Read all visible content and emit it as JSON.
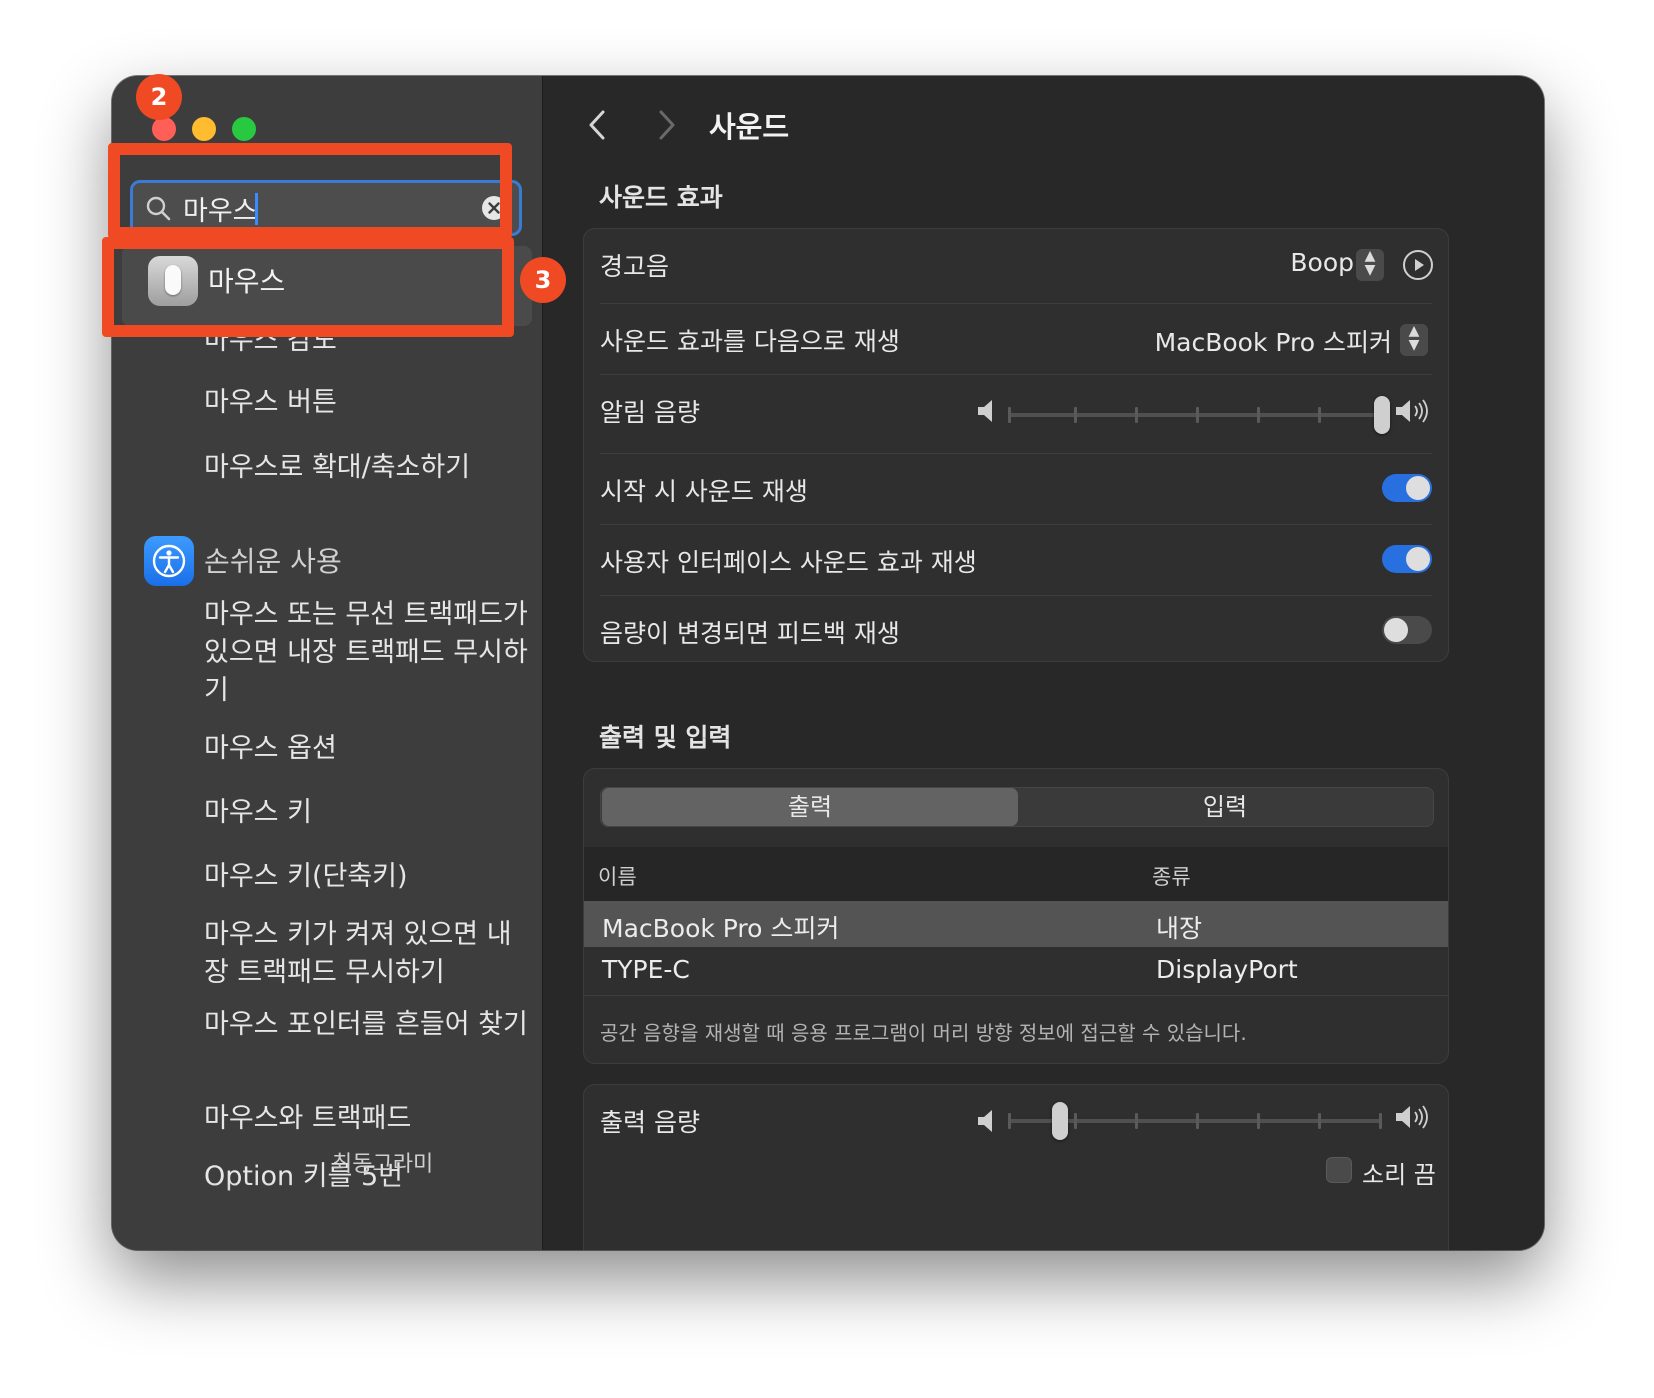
{
  "sidebar": {
    "search": {
      "value": "마우스"
    },
    "top_result": {
      "label": "마우스"
    },
    "items": [
      {
        "label": "마우스 감도"
      },
      {
        "label": "마우스 버튼"
      },
      {
        "label": "마우스로 확대/축소하기"
      }
    ],
    "accessibility": {
      "category_label": "손쉬운 사용",
      "items": [
        {
          "label": "마우스 또는 무선 트랙패드가 있으면 내장 트랙패드 무시하기"
        },
        {
          "label": "마우스 옵션"
        },
        {
          "label": "마우스 키"
        },
        {
          "label": "마우스 키(단축키)"
        },
        {
          "label": "마우스 키가 켜져 있으면 내장 트랙패드 무시하기"
        },
        {
          "label": "마우스 포인터를 흔들어 찾기"
        },
        {
          "label": "마우스와 트랙패드"
        },
        {
          "label": "Option 키를 5번"
        }
      ]
    },
    "watermark": "최동그라미"
  },
  "main": {
    "title": "사운드",
    "sound_effects": {
      "section_title": "사운드 효과",
      "alert_sound": {
        "label": "경고음",
        "value": "Boop"
      },
      "play_through": {
        "label": "사운드 효과를 다음으로 재생",
        "value": "MacBook Pro 스피커"
      },
      "alert_volume": {
        "label": "알림 음량",
        "level": 1.0
      },
      "startup_sound": {
        "label": "시작 시 사운드 재생",
        "on": true
      },
      "ui_sound": {
        "label": "사용자 인터페이스 사운드 효과 재생",
        "on": true
      },
      "feedback": {
        "label": "음량이 변경되면 피드백 재생",
        "on": false
      }
    },
    "output_input": {
      "section_title": "출력 및 입력",
      "tabs": [
        {
          "label": "출력",
          "selected": true
        },
        {
          "label": "입력",
          "selected": false
        }
      ],
      "columns": [
        "이름",
        "종류"
      ],
      "devices": [
        {
          "name": "MacBook Pro 스피커",
          "type": "내장",
          "selected": true
        },
        {
          "name": "TYPE-C",
          "type": "DisplayPort",
          "selected": false
        }
      ],
      "note": "공간 음향을 재생할 때 응용 프로그램이 머리 방향 정보에 접근할 수 있습니다."
    },
    "output_volume": {
      "label": "출력 음량",
      "level": 0.14,
      "mute_label": "소리 끔",
      "muted": false
    }
  },
  "annotations": {
    "badge_2": "2",
    "badge_3": "3",
    "color": "#f04a24"
  },
  "colors": {
    "accent": "#2870e0",
    "close": "#ff5f57",
    "minimize": "#febc2e",
    "maximize": "#28c840"
  }
}
